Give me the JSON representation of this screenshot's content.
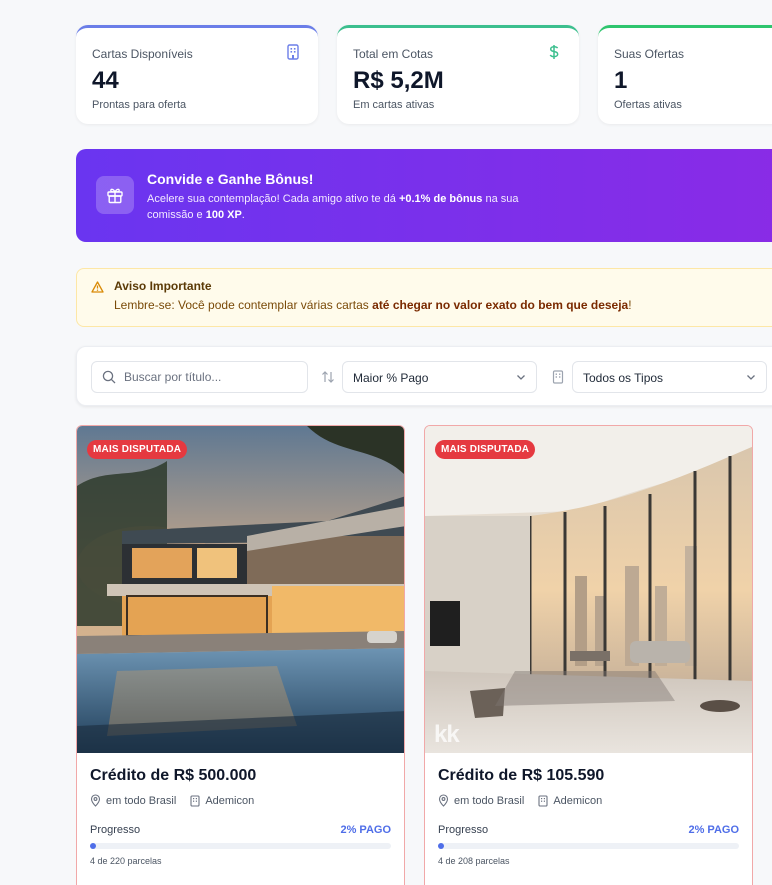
{
  "stats": [
    {
      "label": "Cartas Disponíveis",
      "value": "44",
      "sub": "Prontas para oferta",
      "icon": "building-icon"
    },
    {
      "label": "Total em Cotas",
      "value": "R$ 5,2M",
      "sub": "Em cartas ativas",
      "icon": "dollar-icon"
    },
    {
      "label": "Suas Ofertas",
      "value": "1",
      "sub": "Ofertas ativas",
      "icon": ""
    }
  ],
  "banner": {
    "title": "Convide e Ganhe Bônus!",
    "text_1": "Acelere sua contemplação! Cada amigo ativo te dá ",
    "text_bold_1": "+0.1% de bônus",
    "text_2": " na sua comissão e ",
    "text_bold_2": "100 XP",
    "text_3": ".",
    "icon": "gift-icon"
  },
  "notice": {
    "title": "Aviso Importante",
    "text_1": "Lembre-se: Você pode contemplar várias cartas ",
    "text_bold": "até chegar no valor exato do bem que deseja",
    "text_2": "!",
    "icon": "warning-icon"
  },
  "filters": {
    "search_placeholder": "Buscar por título...",
    "sort_value": "Maior % Pago",
    "type_value": "Todos os Tipos"
  },
  "cards": [
    {
      "badge": "MAIS DISPUTADA",
      "title": "Crédito de R$ 500.000",
      "location": "em todo Brasil",
      "company": "Ademicon",
      "progress_label": "Progresso",
      "progress_pct_label": "2% PAGO",
      "progress": 0.02,
      "installments": "4 de 220 parcelas"
    },
    {
      "badge": "MAIS DISPUTADA",
      "title": "Crédito de R$ 105.590",
      "location": "em todo Brasil",
      "company": "Ademicon",
      "progress_label": "Progresso",
      "progress_pct_label": "2% PAGO",
      "progress": 0.02,
      "installments": "4 de 208 parcelas",
      "watermark": "kk"
    }
  ],
  "colors": {
    "accent": "#4f6ee8",
    "banner_start": "#6a35f0",
    "banner_end": "#8a2be6",
    "badge": "#e53940"
  }
}
